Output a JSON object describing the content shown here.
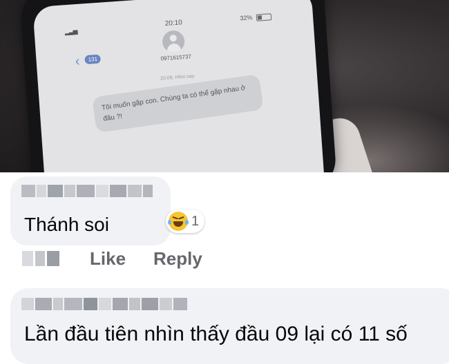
{
  "phone": {
    "status_time": "20:10",
    "battery": "32%",
    "back_count": "131",
    "contact_number": "0971615737",
    "message_date": "20:09, Hôm nay",
    "message_text": "Tôi muốn gặp con. Chùng ta có thể gặp nhau ở đâu ?!"
  },
  "comments": [
    {
      "text": "Thánh soi",
      "reaction_icon": "laughing-emoji-icon",
      "reaction_count": "1",
      "actions": {
        "like": "Like",
        "reply": "Reply"
      }
    },
    {
      "text": "Lần đầu tiên nhìn thấy đầu 09 lại có 11 số"
    }
  ],
  "colors": {
    "comment_bg": "#f0f2f5",
    "action_text": "#65676b",
    "phone_accent": "#6c8fd0"
  }
}
